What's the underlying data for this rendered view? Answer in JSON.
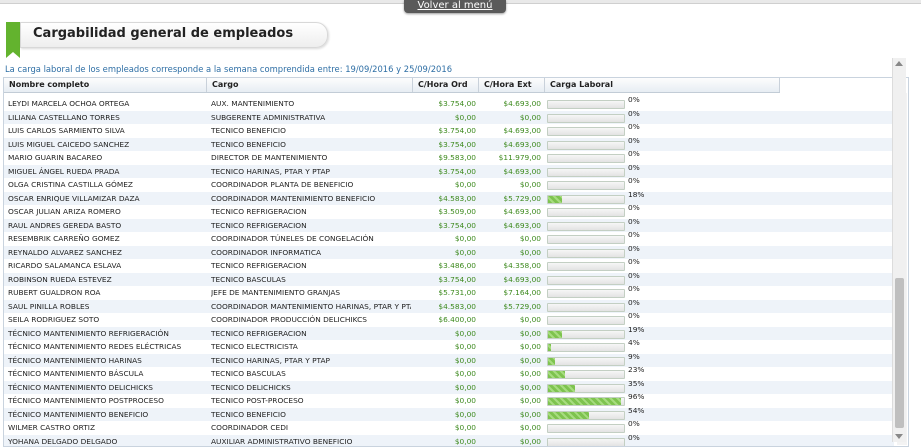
{
  "nav": {
    "back_label": "Volver al menú"
  },
  "header": {
    "title": "Cargabilidad general de empleados"
  },
  "period_text": "La carga laboral de los empleados corresponde a la semana comprendida entre: 19/09/2016 y 25/09/2016",
  "table": {
    "columns": [
      "Nombre completo",
      "Cargo",
      "C/Hora Ord",
      "C/Hora Ext",
      "Carga Laboral"
    ],
    "rows": [
      {
        "name": "LEYDI MARCELA OCHOA ORTEGA",
        "cargo": "AUX. MANTENIMIENTO",
        "ord": "$3.754,00",
        "ext": "$4.693,00",
        "pct": "0%",
        "load": 0
      },
      {
        "name": "LILIANA CASTELLANO TORRES",
        "cargo": "SUBGERENTE ADMINISTRATIVA",
        "ord": "$0,00",
        "ext": "$0,00",
        "pct": "0%",
        "load": 0
      },
      {
        "name": "LUIS CARLOS SARMIENTO SILVA",
        "cargo": "TECNICO BENEFICIO",
        "ord": "$3.754,00",
        "ext": "$4.693,00",
        "pct": "0%",
        "load": 0
      },
      {
        "name": "LUIS MIGUEL CAICEDO SANCHEZ",
        "cargo": "TECNICO BENEFICIO",
        "ord": "$3.754,00",
        "ext": "$4.693,00",
        "pct": "0%",
        "load": 0
      },
      {
        "name": "MARIO GUARIN BACAREO",
        "cargo": "DIRECTOR DE MANTENIMIENTO",
        "ord": "$9.583,00",
        "ext": "$11.979,00",
        "pct": "0%",
        "load": 0
      },
      {
        "name": "MIGUEL ÁNGEL RUEDA PRADA",
        "cargo": "TECNICO HARINAS, PTAR Y PTAP",
        "ord": "$3.754,00",
        "ext": "$4.693,00",
        "pct": "0%",
        "load": 0
      },
      {
        "name": "OLGA CRISTINA CASTILLA GÓMEZ",
        "cargo": "COORDINADOR PLANTA DE BENEFICIO",
        "ord": "$0,00",
        "ext": "$0,00",
        "pct": "0%",
        "load": 0
      },
      {
        "name": "OSCAR ENRIQUE VILLAMIZAR DAZA",
        "cargo": "COORDINADOR MANTENIMIENTO BENEFICIO",
        "ord": "$4.583,00",
        "ext": "$5.729,00",
        "pct": "18%",
        "load": 18
      },
      {
        "name": "OSCAR JULIAN ARIZA ROMERO",
        "cargo": "TECNICO REFRIGERACION",
        "ord": "$3.509,00",
        "ext": "$4.693,00",
        "pct": "0%",
        "load": 0
      },
      {
        "name": "RAUL ANDRES GEREDA BASTO",
        "cargo": "TECNICO REFRIGERACION",
        "ord": "$3.754,00",
        "ext": "$4.693,00",
        "pct": "0%",
        "load": 0
      },
      {
        "name": "RESEMBRIK CARREÑO GOMEZ",
        "cargo": "COORDINADOR TÚNELES DE CONGELACIÓN",
        "ord": "$0,00",
        "ext": "$0,00",
        "pct": "0%",
        "load": 0
      },
      {
        "name": "REYNALDO ALVAREZ SANCHEZ",
        "cargo": "COORDINADOR INFORMATICA",
        "ord": "$0,00",
        "ext": "$0,00",
        "pct": "0%",
        "load": 0
      },
      {
        "name": "RICARDO SALAMANCA ESLAVA",
        "cargo": "TECNICO REFRIGERACION",
        "ord": "$3.486,00",
        "ext": "$4.358,00",
        "pct": "0%",
        "load": 0
      },
      {
        "name": "ROBINSON RUEDA ESTEVEZ",
        "cargo": "TECNICO BASCULAS",
        "ord": "$3.754,00",
        "ext": "$4.693,00",
        "pct": "0%",
        "load": 0
      },
      {
        "name": "RUBERT GUALDRON ROA",
        "cargo": "JEFE DE MANTENIMIENTO GRANJAS",
        "ord": "$5.731,00",
        "ext": "$7.164,00",
        "pct": "0%",
        "load": 0
      },
      {
        "name": "SAUL PINILLA ROBLES",
        "cargo": "COORDINADOR MANTENIMIENTO HARINAS, PTAR Y PTA",
        "ord": "$4.583,00",
        "ext": "$5.729,00",
        "pct": "0%",
        "load": 0
      },
      {
        "name": "SEILA RODRIGUEZ SOTO",
        "cargo": "COORDINADOR PRODUCCIÓN DELICHIKCS",
        "ord": "$6.400,00",
        "ext": "$0,00",
        "pct": "0%",
        "load": 0
      },
      {
        "name": "TÉCNICO MANTENIMIENTO REFRIGERACIÓN",
        "cargo": "TECNICO REFRIGERACION",
        "ord": "$0,00",
        "ext": "$0,00",
        "pct": "19%",
        "load": 19
      },
      {
        "name": "TÉCNICO MANTENIMIENTO REDES ELÉCTRICAS",
        "cargo": "TECNICO ELECTRICISTA",
        "ord": "$0,00",
        "ext": "$0,00",
        "pct": "4%",
        "load": 4
      },
      {
        "name": "TÉCNICO MANTENIMIENTO HARINAS",
        "cargo": "TECNICO HARINAS, PTAR Y PTAP",
        "ord": "$0,00",
        "ext": "$0,00",
        "pct": "9%",
        "load": 9
      },
      {
        "name": "TÉCNICO MANTENIMIENTO BÁSCULA",
        "cargo": "TECNICO BASCULAS",
        "ord": "$0,00",
        "ext": "$0,00",
        "pct": "23%",
        "load": 23
      },
      {
        "name": "TÉCNICO MANTENIMIENTO DELICHICKS",
        "cargo": "TECNICO DELICHICKS",
        "ord": "$0,00",
        "ext": "$0,00",
        "pct": "35%",
        "load": 35
      },
      {
        "name": "TÉCNICO MANTENIMIENTO POSTPROCESO",
        "cargo": "TECNICO POST-PROCESO",
        "ord": "$0,00",
        "ext": "$0,00",
        "pct": "96%",
        "load": 96
      },
      {
        "name": "TÉCNICO MANTENIMIENTO BENEFICIO",
        "cargo": "TECNICO BENEFICIO",
        "ord": "$0,00",
        "ext": "$0,00",
        "pct": "54%",
        "load": 54
      },
      {
        "name": "WILMER CASTRO ORTIZ",
        "cargo": "COORDINADOR CEDI",
        "ord": "$0,00",
        "ext": "$0,00",
        "pct": "0%",
        "load": 0
      },
      {
        "name": "YOHANA DELGADO DELGADO",
        "cargo": "AUXILIAR ADMINISTRATIVO BENEFICIO",
        "ord": "$0,00",
        "ext": "$0,00",
        "pct": "0%",
        "load": 0
      }
    ]
  },
  "colors": {
    "accent": "#63b32e",
    "money": "#3d8a1e",
    "link": "#2f6fa5"
  }
}
